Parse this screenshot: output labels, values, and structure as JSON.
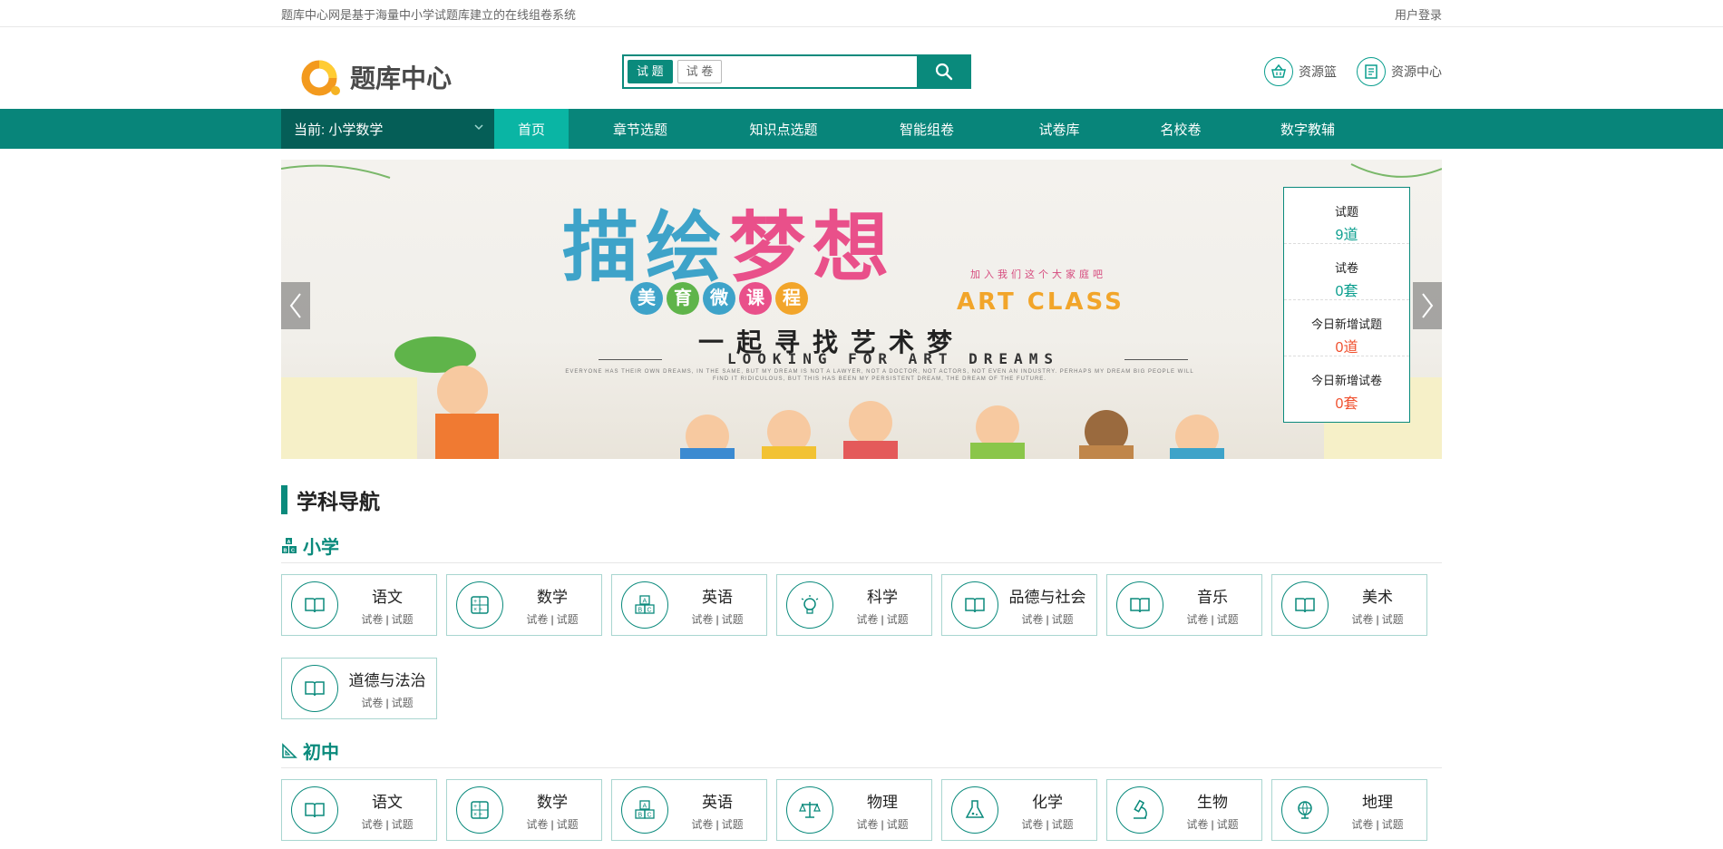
{
  "topbar": {
    "tagline": "题库中心网是基于海量中小学试题库建立的在线组卷系统",
    "login": "用户登录"
  },
  "header": {
    "logo_text": "题库中心",
    "search": {
      "tab_active": "试 题",
      "tab_other": "试 卷",
      "placeholder": ""
    },
    "links": [
      {
        "label": "资源篮",
        "icon": "basket-icon"
      },
      {
        "label": "资源中心",
        "icon": "document-icon"
      }
    ]
  },
  "nav": {
    "current": "当前: 小学数学",
    "items": [
      "首页",
      "章节选题",
      "知识点选题",
      "智能组卷",
      "试卷库",
      "名校卷",
      "数字教辅"
    ]
  },
  "banner": {
    "title_a": "描绘",
    "title_b": "梦想",
    "sub": [
      "美",
      "育",
      "微",
      "课",
      "程"
    ],
    "join": "加入我们这个大家庭吧",
    "art": "ART CLASS",
    "line1": "一起寻找艺术梦",
    "line2": "LOOKING FOR ART DREAMS",
    "fine": "EVERYONE HAS THEIR OWN DREAMS, IN THE SAME, BUT MY DREAM IS NOT A LAWYER, NOT A DOCTOR, NOT ACTORS, NOT EVEN AN INDUSTRY. PERHAPS MY DREAM BIG PEOPLE WILL FIND IT RIDICULOUS, BUT THIS HAS BEEN MY PERSISTENT DREAM, THE DREAM OF THE FUTURE."
  },
  "stats": [
    {
      "label": "试题",
      "value": "9道",
      "tone": "teal"
    },
    {
      "label": "试卷",
      "value": "0套",
      "tone": "teal"
    },
    {
      "label": "今日新增试题",
      "value": "0道",
      "tone": "red"
    },
    {
      "label": "今日新增试卷",
      "value": "0套",
      "tone": "red"
    }
  ],
  "subject_nav_title": "学科导航",
  "levels": [
    {
      "name": "小学",
      "icon": "abc-blocks-icon",
      "subjects": [
        {
          "name": "语文",
          "icon": "book-icon"
        },
        {
          "name": "数学",
          "icon": "calculator-icon"
        },
        {
          "name": "英语",
          "icon": "abc-blocks-icon"
        },
        {
          "name": "科学",
          "icon": "lightbulb-icon"
        },
        {
          "name": "品德与社会",
          "icon": "book-icon"
        },
        {
          "name": "音乐",
          "icon": "book-icon"
        },
        {
          "name": "美术",
          "icon": "book-icon"
        },
        {
          "name": "道德与法治",
          "icon": "book-icon"
        }
      ]
    },
    {
      "name": "初中",
      "icon": "ruler-triangle-icon",
      "subjects": [
        {
          "name": "语文",
          "icon": "book-icon"
        },
        {
          "name": "数学",
          "icon": "calculator-icon"
        },
        {
          "name": "英语",
          "icon": "abc-blocks-icon"
        },
        {
          "name": "物理",
          "icon": "balance-scale-icon"
        },
        {
          "name": "化学",
          "icon": "flask-icon"
        },
        {
          "name": "生物",
          "icon": "microscope-icon"
        },
        {
          "name": "地理",
          "icon": "globe-icon"
        }
      ]
    }
  ],
  "card_links": {
    "papers": "试卷",
    "questions": "试题"
  },
  "colors": {
    "brand": "#0a8a7c",
    "nav_current": "#055e57",
    "nav_active": "#0ab5a4",
    "stat_red": "#f0502e"
  }
}
